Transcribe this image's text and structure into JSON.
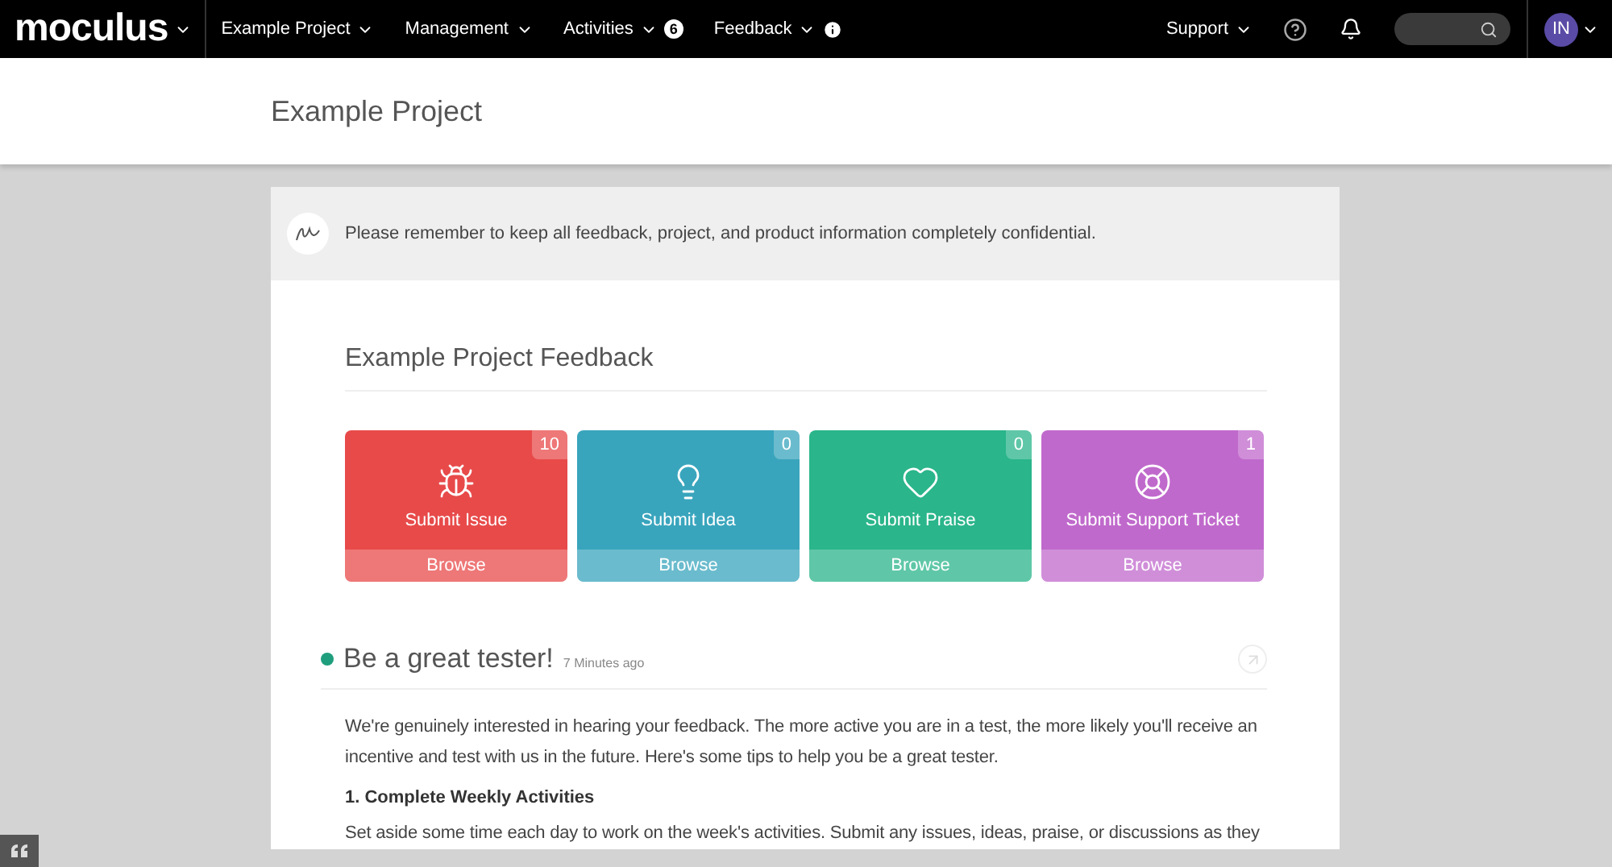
{
  "nav": {
    "logo": "moculus",
    "items": [
      {
        "label": "Example Project"
      },
      {
        "label": "Management"
      },
      {
        "label": "Activities",
        "badge": "6"
      },
      {
        "label": "Feedback",
        "info": true
      }
    ],
    "support": "Support",
    "avatar": "IN"
  },
  "header": {
    "title": "Example Project"
  },
  "notice": "Please remember to keep all feedback, project, and product information completely confidential.",
  "feedback": {
    "title": "Example Project Feedback",
    "tiles": [
      {
        "kind": "bug",
        "label": "Submit Issue",
        "count": "10",
        "browse": "Browse",
        "color": "#e84a4a"
      },
      {
        "kind": "idea",
        "label": "Submit Idea",
        "count": "0",
        "browse": "Browse",
        "color": "#39a5bd"
      },
      {
        "kind": "praise",
        "label": "Submit Praise",
        "count": "0",
        "browse": "Browse",
        "color": "#2ab58a"
      },
      {
        "kind": "support",
        "label": "Submit Support Ticket",
        "count": "1",
        "browse": "Browse",
        "color": "#c069cc"
      }
    ]
  },
  "post": {
    "title": "Be a great tester!",
    "time": "7 Minutes ago",
    "blocks": [
      {
        "kind": "paragraph",
        "text": "We're genuinely interested in hearing your feedback.  The more active you are in a test, the more likely you'll receive an incentive and test with us in the future. Here's some tips to help you be a great tester."
      },
      {
        "kind": "heading",
        "text": "1. Complete Weekly Activities"
      },
      {
        "kind": "paragraph",
        "text": "Set aside some time each day to work on the week's activities. Submit any issues, ideas, praise, or discussions as they"
      }
    ]
  }
}
